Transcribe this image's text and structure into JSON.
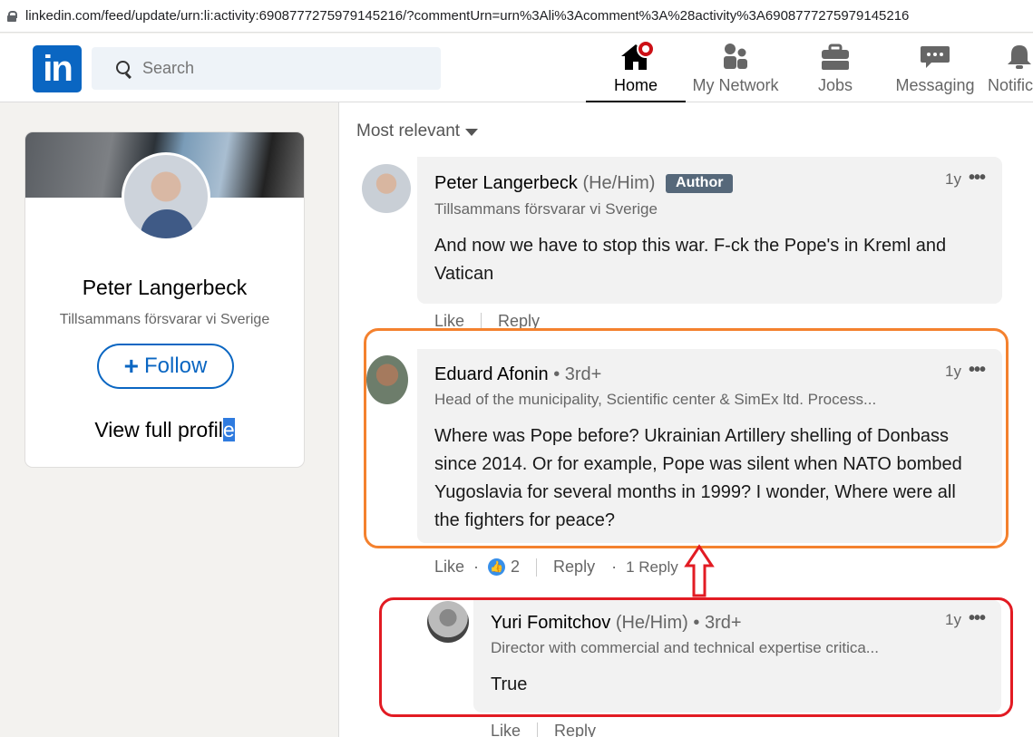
{
  "browser": {
    "url": "linkedin.com/feed/update/urn:li:activity:6908777275979145216/?commentUrn=urn%3Ali%3Acomment%3A%28activity%3A6908777275979145216"
  },
  "nav": {
    "logo": "in",
    "search_placeholder": "Search",
    "items": [
      {
        "label": "Home",
        "icon": "home-icon",
        "active": true
      },
      {
        "label": "My Network",
        "icon": "network-icon"
      },
      {
        "label": "Jobs",
        "icon": "briefcase-icon"
      },
      {
        "label": "Messaging",
        "icon": "messaging-icon"
      },
      {
        "label": "Notifications",
        "icon": "bell-icon"
      }
    ]
  },
  "profile": {
    "name": "Peter Langerbeck",
    "headline": "Tillsammans försvarar vi Sverige",
    "follow_label": "Follow",
    "view_profile_pre": "View full profil",
    "view_profile_sel": "e"
  },
  "feed": {
    "sort_label": "Most relevant",
    "comments": [
      {
        "name": "Peter Langerbeck",
        "pronouns": "(He/Him)",
        "author_tag": "Author",
        "headline": "Tillsammans försvarar vi Sverige",
        "time": "1y",
        "body": "And now we have to stop this war. F-ck the Pope's in Kreml and Vatican",
        "like": "Like",
        "reply": "Reply"
      },
      {
        "name": "Eduard Afonin",
        "degree": "• 3rd+",
        "headline": "Head of the municipality, Scientific center & SimEx ltd. Process...",
        "time": "1y",
        "body": "Where was Pope before? Ukrainian Artillery shelling of Donbass since 2014. Or for example, Pope was silent when NATO bombed Yugoslavia for several months in 1999? I wonder, Where were all the fighters for peace?",
        "like": "Like",
        "reactions": "2",
        "reply": "Reply",
        "replies": "1 Reply"
      },
      {
        "name": "Yuri Fomitchov",
        "pronouns": "(He/Him)",
        "degree": "• 3rd+",
        "headline": "Director with commercial and technical expertise critica...",
        "time": "1y",
        "body": "True",
        "like": "Like",
        "reply": "Reply"
      }
    ]
  },
  "annotations": {
    "highlight_color": "#f4812e",
    "reply_color": "#e21b23",
    "arrow_color": "#e21b23"
  }
}
